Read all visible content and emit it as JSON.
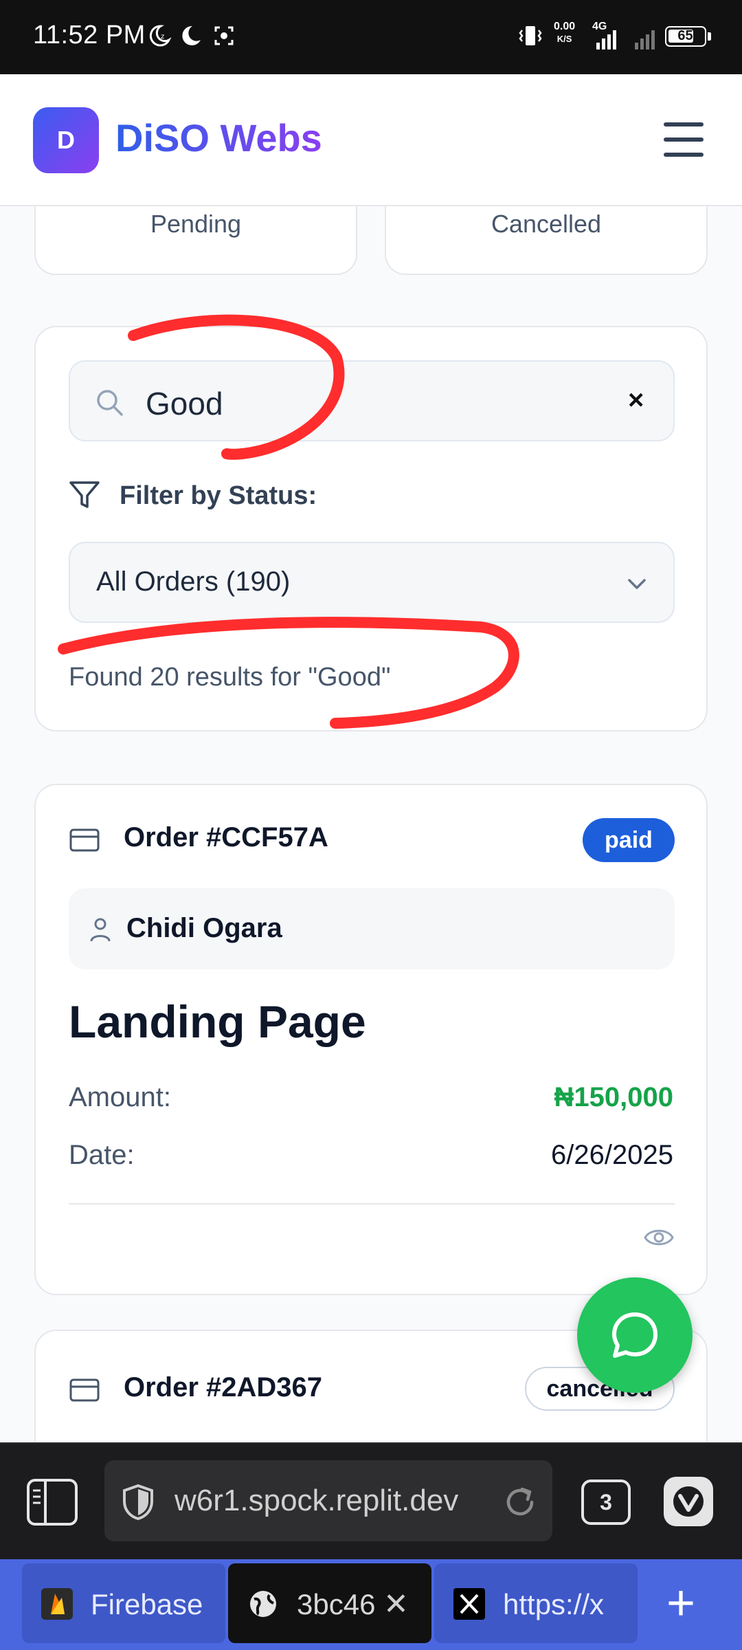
{
  "status_bar": {
    "time": "11:52 PM",
    "net_speed": "0.00",
    "net_unit": "K/S",
    "network": "4G",
    "battery": "65"
  },
  "header": {
    "logo_letter": "D",
    "brand": "DiSO Webs"
  },
  "stats": {
    "left_label": "Pending",
    "right_label": "Cancelled"
  },
  "search": {
    "value": "Good",
    "clear_symbol": "×",
    "filter_label": "Filter by Status:",
    "filter_selected": "All Orders (190)",
    "results_text": "Found 20 results for \"Good\""
  },
  "orders": [
    {
      "title": "Order #CCF57A",
      "status": "paid",
      "customer": "Chidi Ogara",
      "service": "Landing Page",
      "amount_label": "Amount:",
      "amount": "₦150,000",
      "date_label": "Date:",
      "date": "6/26/2025"
    },
    {
      "title": "Order #2AD367",
      "status": "cancelled"
    }
  ],
  "browser": {
    "url": "w6r1.spock.replit.dev",
    "tab_count": "3",
    "tabs": [
      {
        "label": "Firebase"
      },
      {
        "label": "3bc46"
      },
      {
        "label": "https://x"
      }
    ],
    "new_tab_symbol": "+"
  },
  "colors": {
    "accent": "#1d5fdb",
    "amount_green": "#16a34a",
    "fab_green": "#22c55e",
    "tabstrip_blue": "#4b67e0"
  }
}
